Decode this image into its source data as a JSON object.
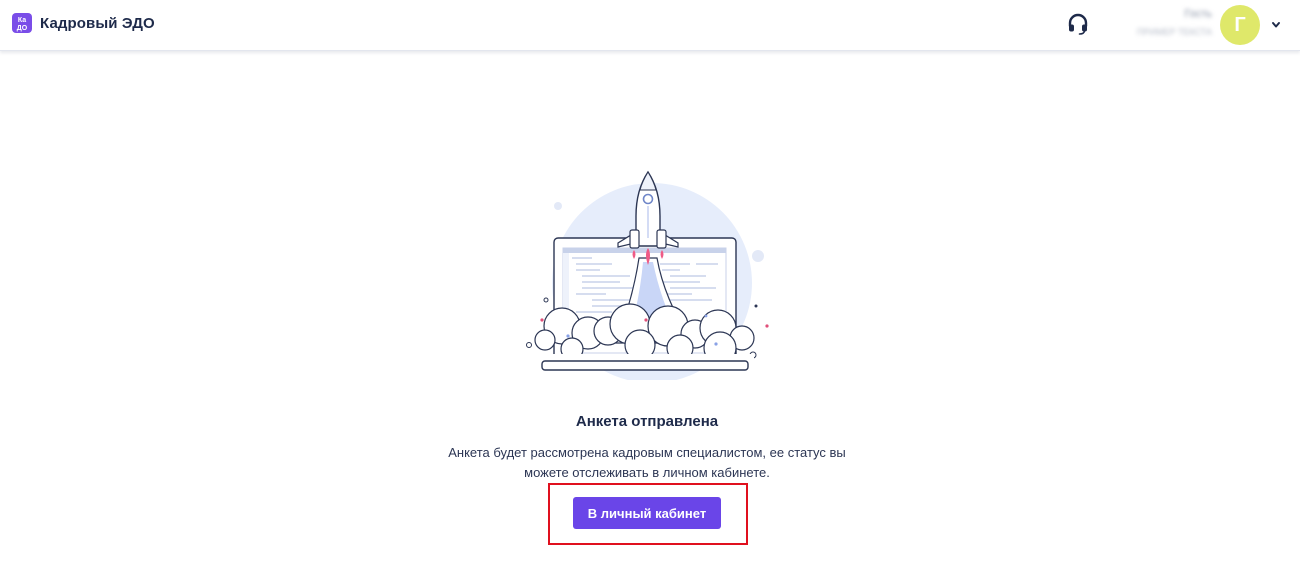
{
  "header": {
    "logo_text": "КаДО",
    "brand": "Кадровый ЭДО",
    "support_icon": "headset-icon",
    "user": {
      "name": "Гость",
      "subtitle": "ПРИМЕР ТЕКСТА",
      "avatar_letter": "Г",
      "avatar_color": "#dfe86a"
    },
    "menu_icon": "chevron-down-icon"
  },
  "main": {
    "illustration": "rocket-launch-illustration",
    "title": "Анкета отправлена",
    "description": "Анкета будет рассмотрена кадровым специалистом, ее статус вы можете отслеживать в личном кабинете.",
    "button_label": "В личный кабинет"
  },
  "colors": {
    "accent": "#6a45e8",
    "highlight_frame": "#e0101e",
    "text": "#1e2a4a"
  }
}
